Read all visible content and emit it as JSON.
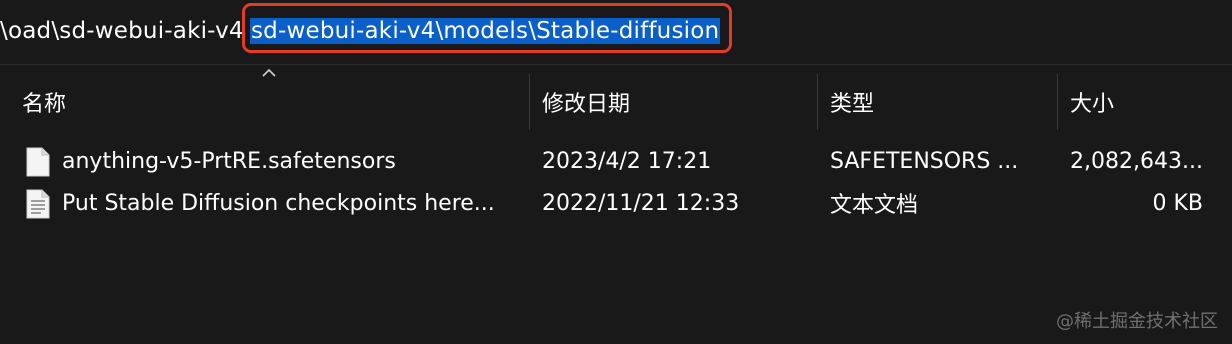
{
  "address_bar": {
    "prefix": "oad\\sd-webui-aki-v4\\",
    "selected_path": "sd-webui-aki-v4\\models\\Stable-diffusion"
  },
  "columns": {
    "name": "名称",
    "modified": "修改日期",
    "type": "类型",
    "size": "大小"
  },
  "files": [
    {
      "name": "anything-v5-PrtRE.safetensors",
      "modified": "2023/4/2 17:21",
      "type": "SAFETENSORS ...",
      "size": "2,082,643..."
    },
    {
      "name": "Put Stable Diffusion checkpoints here...",
      "modified": "2022/11/21 12:33",
      "type": "文本文档",
      "size": "0 KB"
    }
  ],
  "watermark": "@稀土掘金技术社区",
  "colors": {
    "background": "#191919",
    "selection": "#0a5fc8",
    "highlight_border": "#e33b24"
  }
}
